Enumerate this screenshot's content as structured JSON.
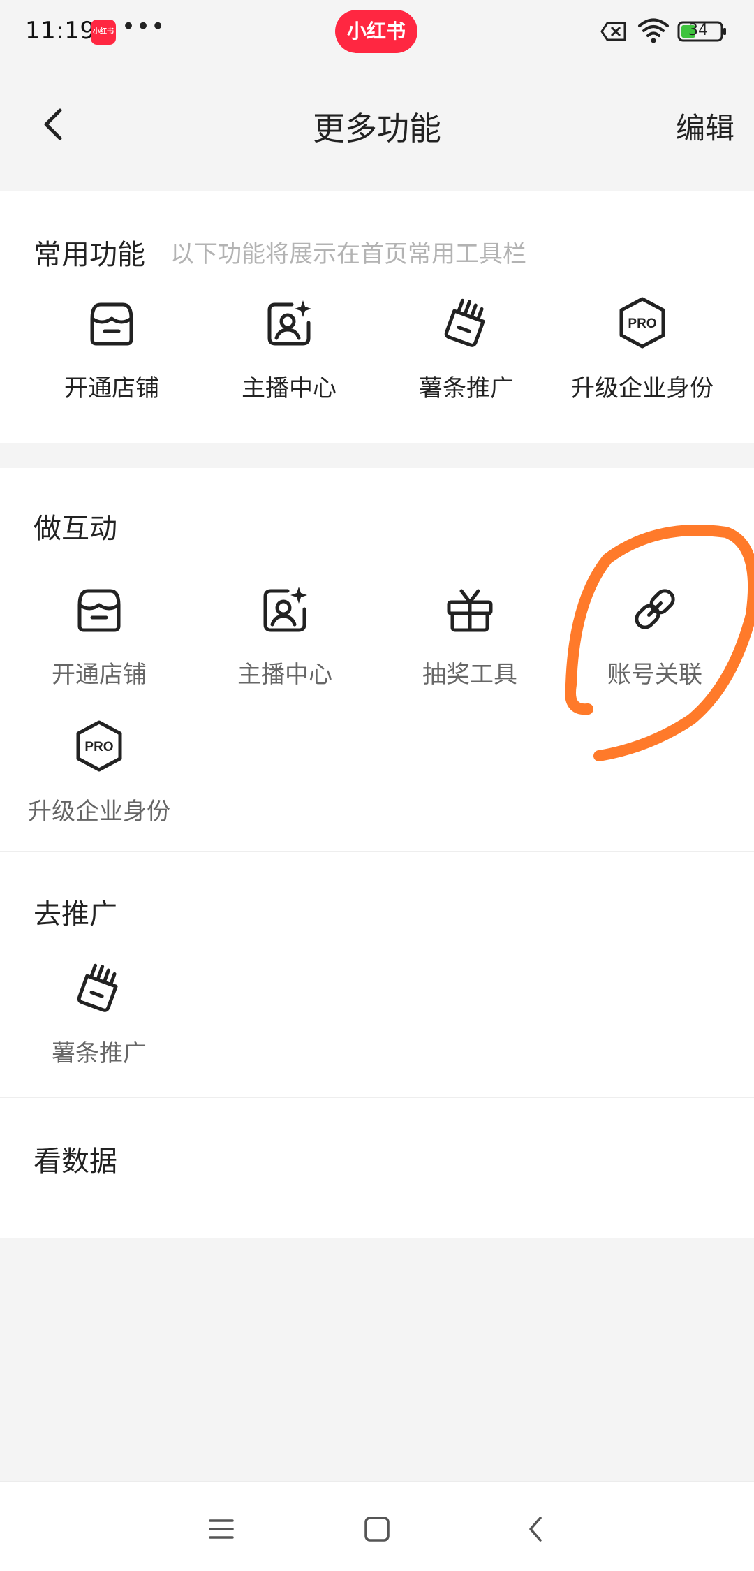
{
  "status_bar": {
    "time": "11:19",
    "app_badge": "小红书",
    "dots": "•••",
    "center_logo": "小红书",
    "battery": "34"
  },
  "header": {
    "title": "更多功能",
    "edit_label": "编辑"
  },
  "sections": {
    "common": {
      "title": "常用功能",
      "hint": "以下功能将展示在首页常用工具栏",
      "items": [
        {
          "label": "开通店铺",
          "icon": "store-icon"
        },
        {
          "label": "主播中心",
          "icon": "anchor-center-icon"
        },
        {
          "label": "薯条推广",
          "icon": "fries-promo-icon"
        },
        {
          "label": "升级企业身份",
          "icon": "pro-badge-icon"
        }
      ]
    },
    "interact": {
      "title": "做互动",
      "items": [
        {
          "label": "开通店铺",
          "icon": "store-icon"
        },
        {
          "label": "主播中心",
          "icon": "anchor-center-icon"
        },
        {
          "label": "抽奖工具",
          "icon": "gift-icon"
        },
        {
          "label": "账号关联",
          "icon": "link-icon"
        },
        {
          "label": "升级企业身份",
          "icon": "pro-badge-icon"
        }
      ]
    },
    "promote": {
      "title": "去推广",
      "items": [
        {
          "label": "薯条推广",
          "icon": "fries-promo-icon"
        }
      ]
    },
    "data": {
      "title": "看数据"
    }
  },
  "annotation_color": "#ff7a2a"
}
